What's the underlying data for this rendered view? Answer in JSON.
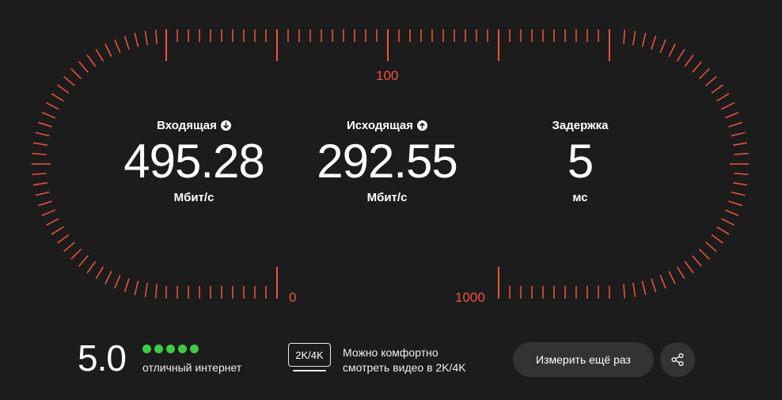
{
  "gauge": {
    "accent_color": "#f2553d",
    "labels": {
      "top": "100",
      "bottom_left": "0",
      "bottom_right": "1000"
    }
  },
  "metrics": {
    "download": {
      "title": "Входящая",
      "icon": "arrow-down-icon",
      "value": "495.28",
      "unit": "Мбит/с"
    },
    "upload": {
      "title": "Исходящая",
      "icon": "arrow-up-icon",
      "value": "292.55",
      "unit": "Мбит/с"
    },
    "ping": {
      "title": "Задержка",
      "value": "5",
      "unit": "мс"
    }
  },
  "rating": {
    "score": "5.0",
    "stars_filled": 5,
    "stars_total": 5,
    "dot_color": "#3fcc44",
    "text": "отличный интернет"
  },
  "quality": {
    "badge": "2K/4K",
    "icon": "tv-icon",
    "line1": "Можно комфортно",
    "line2": "смотреть видео в 2K/4K"
  },
  "actions": {
    "retry_label": "Измерить ещё раз",
    "share_icon": "share-icon"
  }
}
